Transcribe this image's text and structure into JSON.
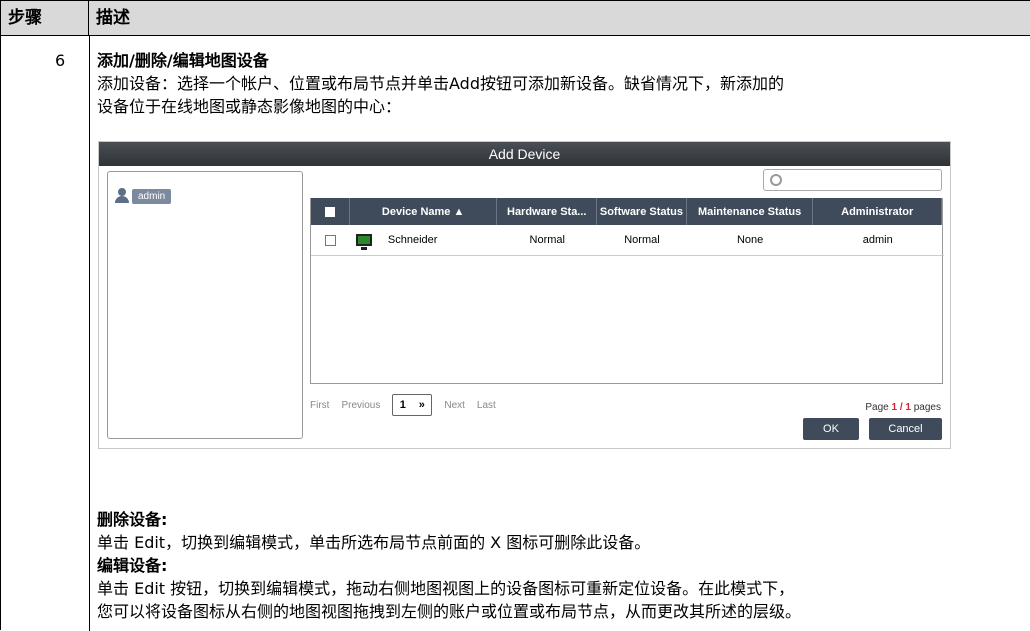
{
  "table": {
    "header_step": "步骤",
    "header_desc": "描述",
    "step_number": "6"
  },
  "content": {
    "heading": "添加/删除/编辑地图设备",
    "add_line1": "添加设备：选择一个帐户、位置或布局节点并单击Add按钮可添加新设备。缺省情况下，新添加的",
    "add_line2": "设备位于在线地图或静态影像地图的中心："
  },
  "dialog": {
    "title": "Add Device",
    "tree_user": "admin",
    "columns": [
      "Device Name ▲",
      "Hardware Sta...",
      "Software Status",
      "Maintenance Status",
      "Administrator"
    ],
    "row": {
      "device_name": "Schneider",
      "hardware_status": "Normal",
      "software_status": "Normal",
      "maintenance_status": "None",
      "administrator": "admin"
    },
    "pager": {
      "first": "First",
      "previous": "Previous",
      "page_value": "1",
      "next": "Next",
      "last": "Last",
      "page_label": "Page",
      "page_current_total": "1 / 1",
      "page_suffix": "pages"
    },
    "ok": "OK",
    "cancel": "Cancel"
  },
  "after": {
    "delete_heading": "删除设备:",
    "delete_text": "单击 Edit，切换到编辑模式，单击所选布局节点前面的 X 图标可删除此设备。",
    "edit_heading": "编辑设备:",
    "edit_line1": "单击 Edit 按钮，切换到编辑模式，拖动右侧地图视图上的设备图标可重新定位设备。在此模式下，",
    "edit_line2": "您可以将设备图标从右侧的地图视图拖拽到左侧的账户或位置或布局节点，从而更改其所述的层级。"
  }
}
